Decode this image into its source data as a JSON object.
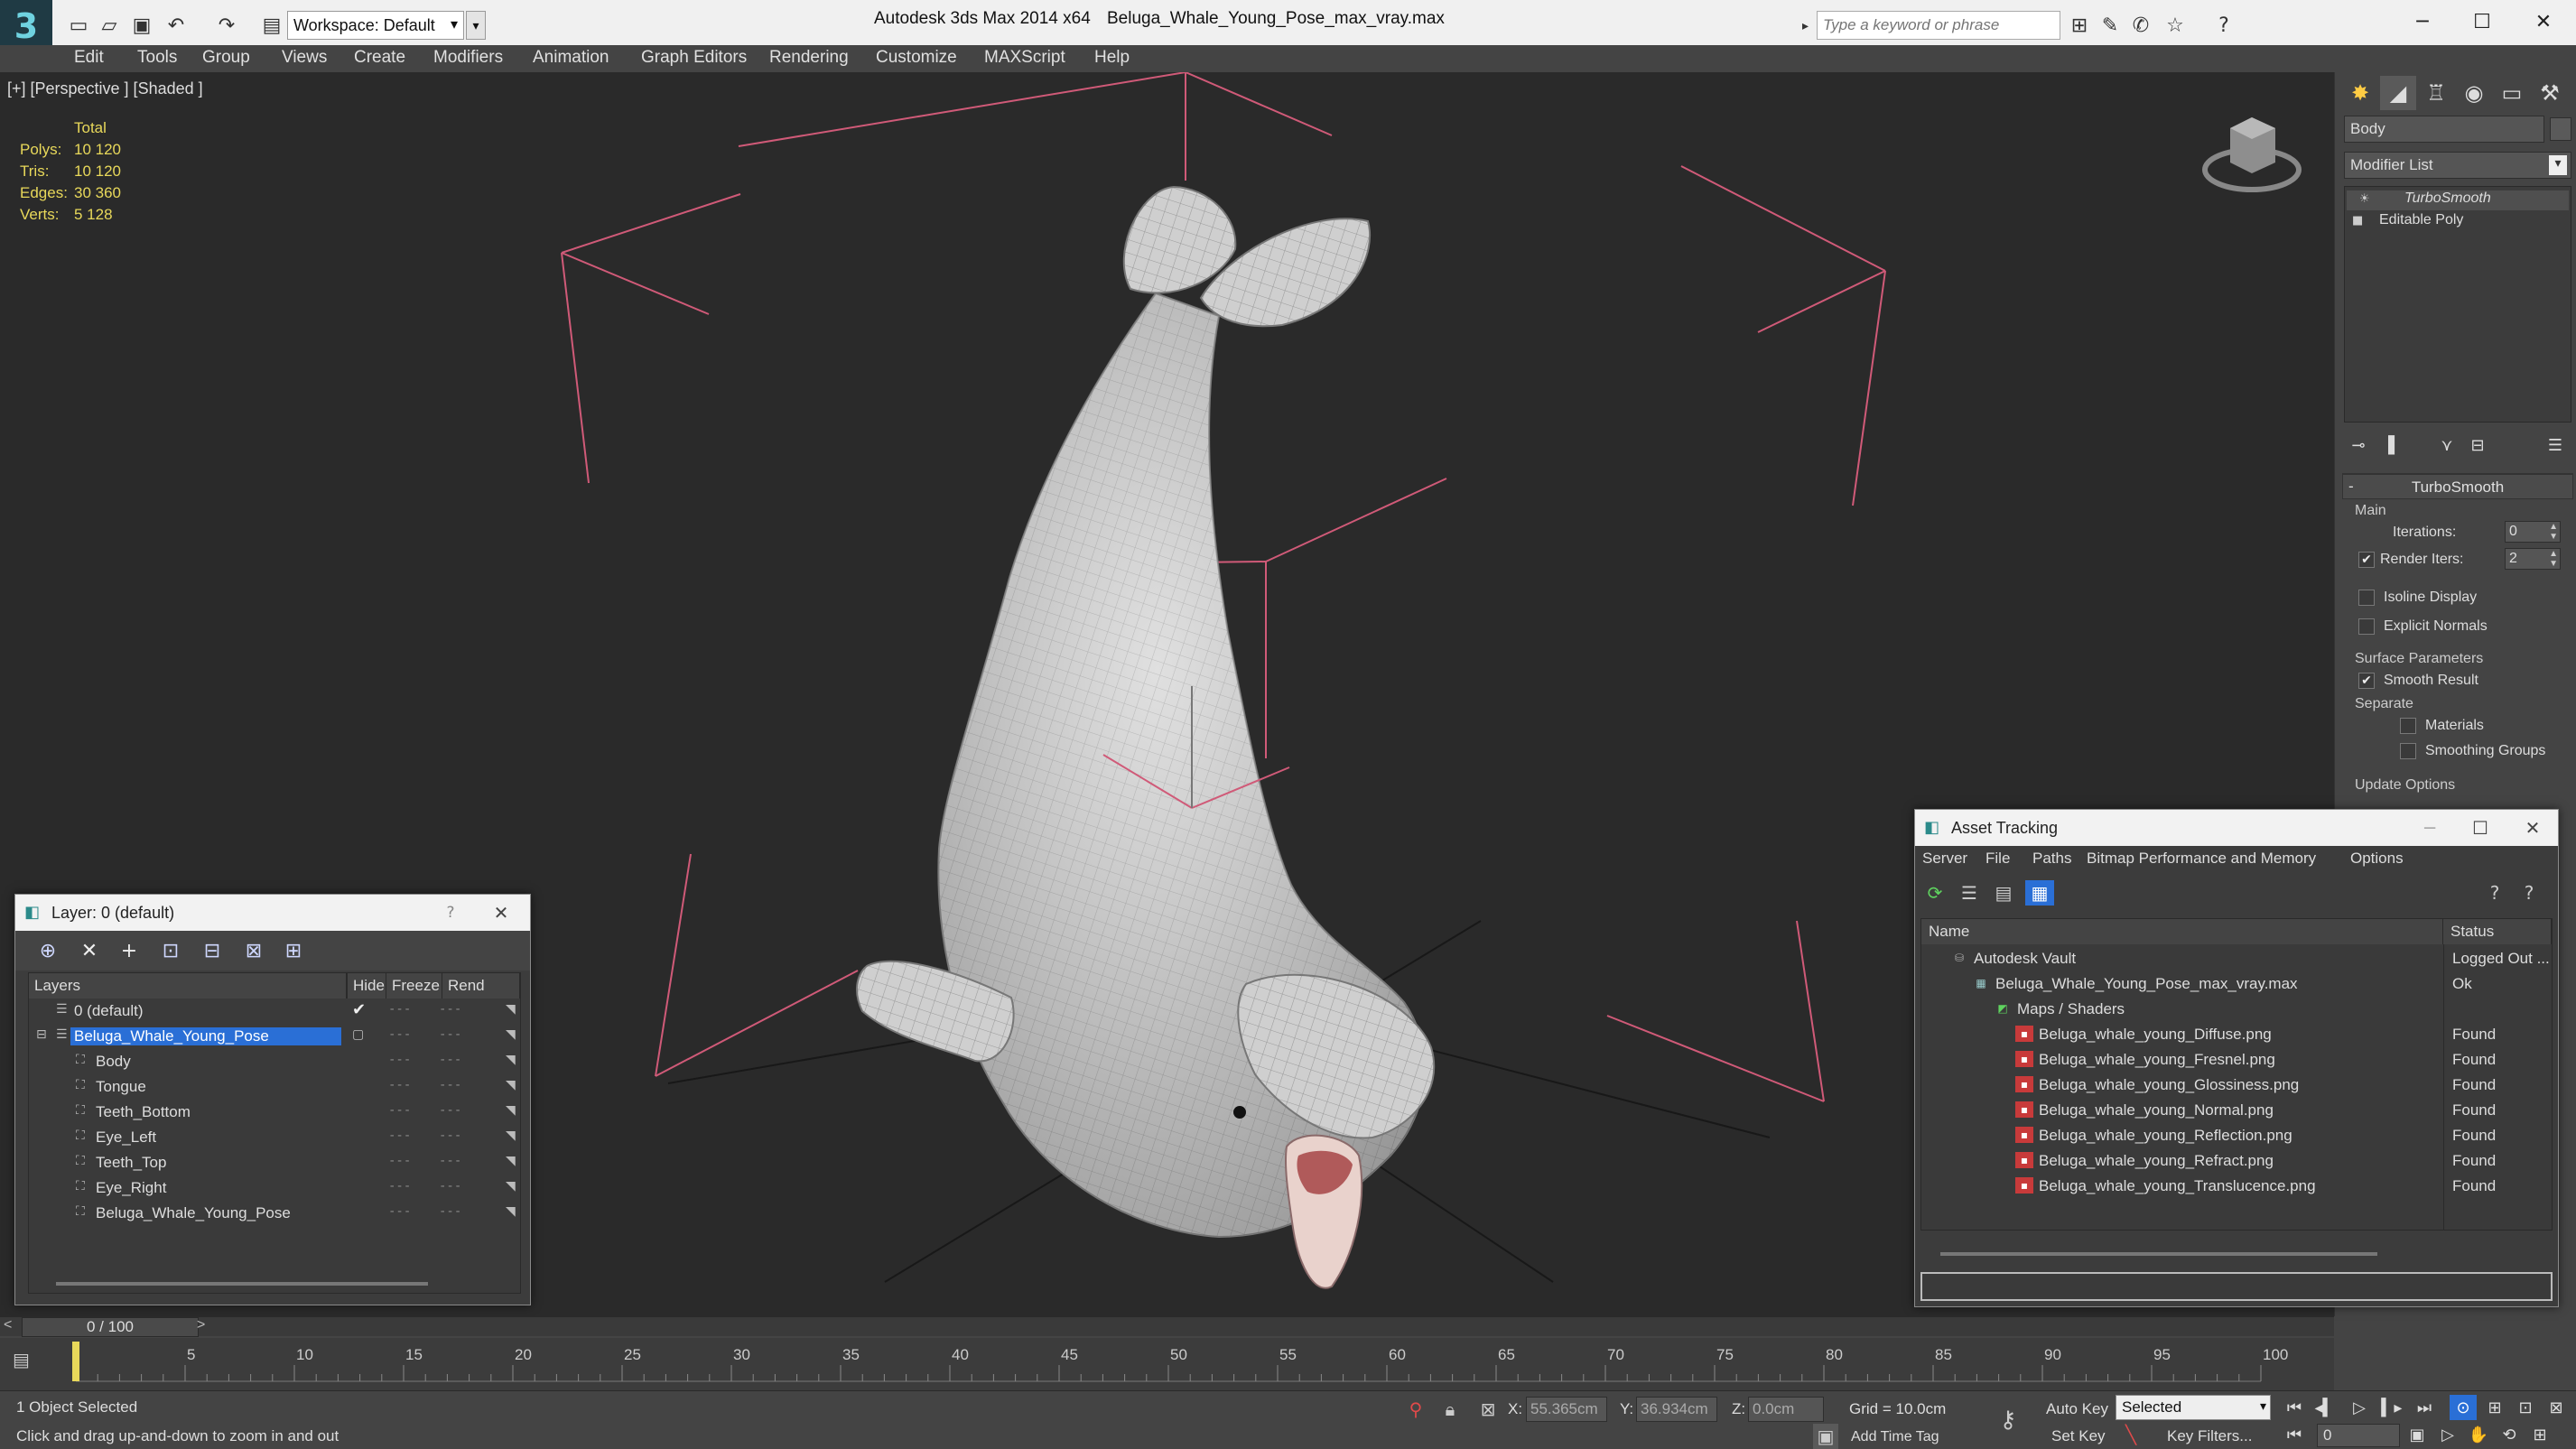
{
  "titlebar": {
    "app_title": "Autodesk 3ds Max  2014 x64",
    "file_title": "Beluga_Whale_Young_Pose_max_vray.max",
    "workspace": "Workspace: Default",
    "search_placeholder": "Type a keyword or phrase"
  },
  "menu": [
    "Edit",
    "Tools",
    "Group",
    "Views",
    "Create",
    "Modifiers",
    "Animation",
    "Graph Editors",
    "Rendering",
    "Customize",
    "MAXScript",
    "Help"
  ],
  "viewport": {
    "label": "[+] [Perspective ] [Shaded ]",
    "stats_header": "Total",
    "stats": [
      {
        "k": "Polys:",
        "v": "10 120"
      },
      {
        "k": "Tris:",
        "v": "10 120"
      },
      {
        "k": "Edges:",
        "v": "30 360"
      },
      {
        "k": "Verts:",
        "v": "5 128"
      }
    ]
  },
  "command_panel": {
    "object_name": "Body",
    "modifier_list": "Modifier List",
    "stack": [
      "TurboSmooth",
      "Editable Poly"
    ],
    "rollout_title": "TurboSmooth",
    "main_label": "Main",
    "iterations_label": "Iterations:",
    "iterations_value": "0",
    "render_iters_label": "Render Iters:",
    "render_iters_value": "2",
    "render_iters_checked": "✔",
    "isoline_label": "Isoline Display",
    "explicit_label": "Explicit Normals",
    "surface_label": "Surface Parameters",
    "smooth_label": "Smooth Result",
    "smooth_checked": "✔",
    "separate_label": "Separate",
    "materials_label": "Materials",
    "smoothing_groups_label": "Smoothing Groups",
    "update_label": "Update Options"
  },
  "layer_window": {
    "title": "Layer: 0 (default)",
    "help": "?",
    "columns": [
      "Layers",
      "Hide",
      "Freeze",
      "Rend"
    ],
    "rows": [
      {
        "name": "0 (default)",
        "indent": 0,
        "active": true
      },
      {
        "name": "Beluga_Whale_Young_Pose",
        "indent": 0,
        "selected": true
      },
      {
        "name": "Body",
        "indent": 1
      },
      {
        "name": "Tongue",
        "indent": 1
      },
      {
        "name": "Teeth_Bottom",
        "indent": 1
      },
      {
        "name": "Eye_Left",
        "indent": 1
      },
      {
        "name": "Teeth_Top",
        "indent": 1
      },
      {
        "name": "Eye_Right",
        "indent": 1
      },
      {
        "name": "Beluga_Whale_Young_Pose",
        "indent": 1
      }
    ]
  },
  "asset_window": {
    "title": "Asset Tracking",
    "menu": [
      "Server",
      "File",
      "Paths",
      "Bitmap Performance and Memory",
      "Options"
    ],
    "columns": [
      "Name",
      "Status"
    ],
    "rows": [
      {
        "name": "Autodesk Vault",
        "status": "Logged Out ...",
        "level": 1,
        "icon": "vault"
      },
      {
        "name": "Beluga_Whale_Young_Pose_max_vray.max",
        "status": "Ok",
        "level": 2,
        "icon": "max"
      },
      {
        "name": "Maps / Shaders",
        "status": "",
        "level": 3,
        "icon": "maps"
      },
      {
        "name": "Beluga_whale_young_Diffuse.png",
        "status": "Found",
        "level": 4,
        "icon": "png"
      },
      {
        "name": "Beluga_whale_young_Fresnel.png",
        "status": "Found",
        "level": 4,
        "icon": "png"
      },
      {
        "name": "Beluga_whale_young_Glossiness.png",
        "status": "Found",
        "level": 4,
        "icon": "png"
      },
      {
        "name": "Beluga_whale_young_Normal.png",
        "status": "Found",
        "level": 4,
        "icon": "png"
      },
      {
        "name": "Beluga_whale_young_Reflection.png",
        "status": "Found",
        "level": 4,
        "icon": "png"
      },
      {
        "name": "Beluga_whale_young_Refract.png",
        "status": "Found",
        "level": 4,
        "icon": "png"
      },
      {
        "name": "Beluga_whale_young_Translucence.png",
        "status": "Found",
        "level": 4,
        "icon": "png"
      }
    ]
  },
  "timeline": {
    "slider": "0 / 100",
    "ticks": [
      0,
      5,
      10,
      15,
      20,
      25,
      30,
      35,
      40,
      45,
      50,
      55,
      60,
      65,
      70,
      75,
      80,
      85,
      90,
      95,
      100
    ],
    "tick_labels": [
      "5",
      "10",
      "15",
      "20",
      "25",
      "30",
      "35",
      "40",
      "45",
      "50",
      "55",
      "60",
      "65",
      "70",
      "75",
      "80",
      "85",
      "90",
      "95",
      "100"
    ]
  },
  "status": {
    "selected": "1 Object Selected",
    "prompt": "Click and drag up-and-down to zoom in and out",
    "x_label": "X:",
    "x_value": "55.365cm",
    "y_label": "Y:",
    "y_value": "36.934cm",
    "z_label": "Z:",
    "z_value": "0.0cm",
    "grid": "Grid = 10.0cm",
    "add_time_tag": "Add Time Tag",
    "auto_key": "Auto Key",
    "set_key": "Set Key",
    "selected_dropdown": "Selected",
    "key_filters": "Key Filters...",
    "frame": "0"
  },
  "colors": {
    "selection_blue": "#2a6fd6",
    "stats_yellow": "#e8d85a",
    "gizmo_pink": "#d05a78",
    "viewport_bg": "#2a2a2a"
  }
}
